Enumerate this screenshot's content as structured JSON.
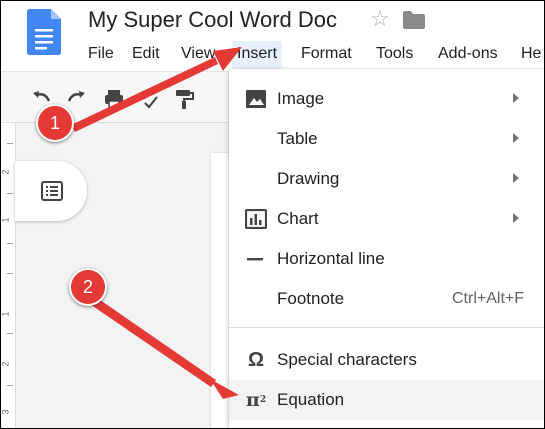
{
  "header": {
    "title": "My Super Cool Word Doc"
  },
  "menubar": {
    "items": [
      "File",
      "Edit",
      "View",
      "Insert",
      "Format",
      "Tools",
      "Add-ons",
      "He"
    ]
  },
  "ruler": {
    "numbers": [
      "2",
      "1",
      "1",
      "2",
      "3"
    ]
  },
  "dropdown": {
    "items": [
      {
        "label": "Image",
        "icon": "image-icon"
      },
      {
        "label": "Table"
      },
      {
        "label": "Drawing"
      },
      {
        "label": "Chart",
        "icon": "chart-icon"
      },
      {
        "label": "Horizontal line",
        "icon": "horizontal-line-icon"
      },
      {
        "label": "Footnote",
        "shortcut": "Ctrl+Alt+F"
      },
      {
        "label": "Special characters",
        "icon": "omega-icon"
      },
      {
        "label": "Equation",
        "icon": "pi-squared-icon"
      }
    ]
  },
  "annotations": {
    "badge1": "1",
    "badge2": "2"
  },
  "colors": {
    "accent_red": "#e53935",
    "menu_active": "#e8f0fe",
    "docs_blue": "#4285f4"
  }
}
